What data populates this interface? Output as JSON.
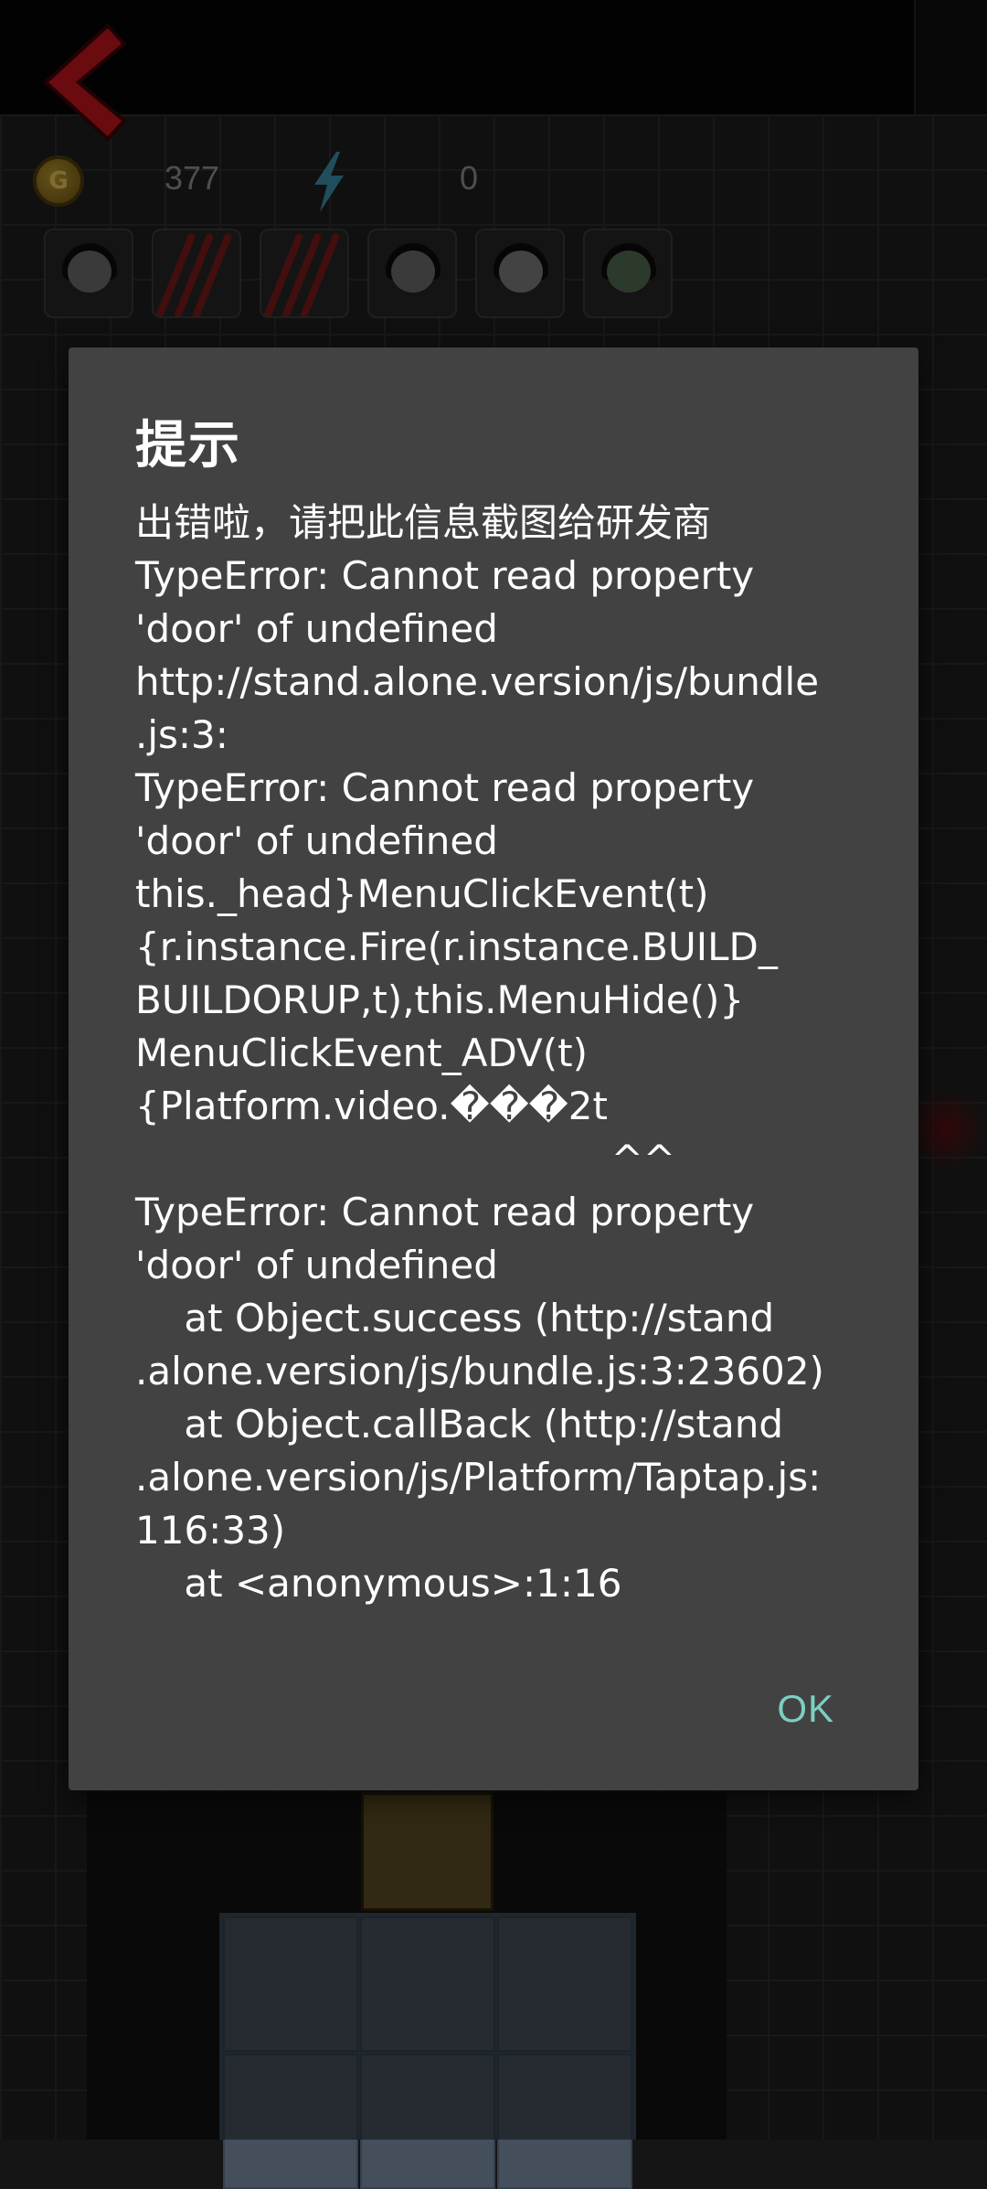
{
  "hud": {
    "coin_icon_label": "G",
    "coins": "377",
    "energy": "0",
    "icons": {
      "coin": "coin-icon",
      "energy": "lightning-icon",
      "back": "back-arrow-icon"
    }
  },
  "dialog": {
    "title": "提示",
    "message_lines": [
      "出错啦，请把此信息截图给研发商",
      "TypeError: Cannot read property",
      "'door' of undefined",
      "http://stand.alone.version/js/bundle",
      ".js:3:",
      "TypeError: Cannot read property",
      "'door' of undefined",
      "this._head}MenuClickEvent(t)",
      "{r.instance.Fire(r.instance.BUILD_",
      "BUILDORUP,t),this.MenuHide()}",
      "MenuClickEvent_ADV(t)",
      "{Platform.video.���2t",
      "                                       ^^",
      "TypeError: Cannot read property",
      "'door' of undefined",
      "    at Object.success (http://stand",
      ".alone.version/js/bundle.js:3:23602)",
      "    at Object.callBack (http://stand",
      ".alone.version/js/Platform/Taptap.js:",
      "116:33)",
      "    at <anonymous>:1:16"
    ],
    "ok_label": "OK"
  },
  "colors": {
    "dialog_bg": "#424242",
    "accent": "#7ccfc2",
    "back_arrow": "#c0141c"
  }
}
